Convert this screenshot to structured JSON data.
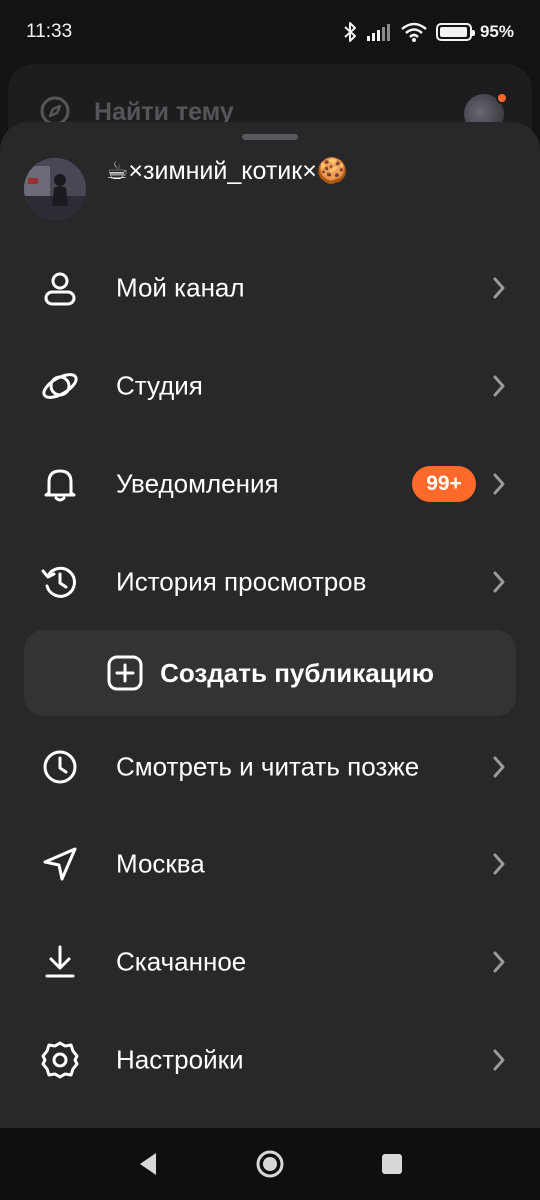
{
  "status_bar": {
    "time": "11:33",
    "battery_percent_text": "95%",
    "battery_level": 0.95
  },
  "background": {
    "search_placeholder": "Найти тему"
  },
  "profile": {
    "name": "☕×зимний_котик×🍪"
  },
  "menu": {
    "items": [
      {
        "label": "Мой канал",
        "icon": "person-icon"
      },
      {
        "label": "Студия",
        "icon": "studio-orbit-icon"
      },
      {
        "label": "Уведомления",
        "icon": "bell-icon",
        "badge": "99+"
      },
      {
        "label": "История просмотров",
        "icon": "history-icon"
      },
      {
        "label": "Смотреть и читать позже",
        "icon": "clock-icon"
      },
      {
        "label": "Москва",
        "icon": "location-arrow-icon"
      },
      {
        "label": "Скачанное",
        "icon": "download-icon"
      },
      {
        "label": "Настройки",
        "icon": "gear-icon"
      }
    ],
    "create_label": "Создать публикацию"
  },
  "colors": {
    "sheet": "#28282b",
    "accent": "#ff6a2a",
    "create_button": "#333336"
  }
}
